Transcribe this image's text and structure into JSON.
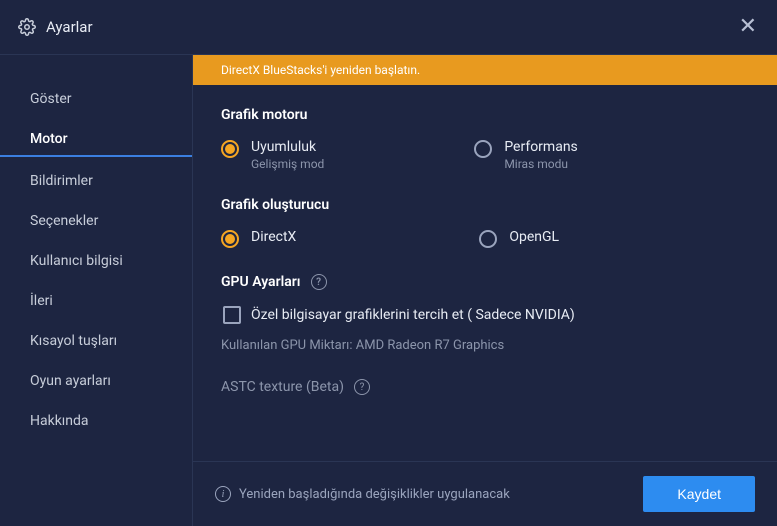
{
  "title": "Ayarlar",
  "alert": "DirectX BlueStacks'i yeniden başlatın.",
  "sidebar": {
    "items": [
      {
        "label": "Göster"
      },
      {
        "label": "Motor"
      },
      {
        "label": "Bildirimler"
      },
      {
        "label": "Seçenekler"
      },
      {
        "label": "Kullanıcı bilgisi"
      },
      {
        "label": "İleri"
      },
      {
        "label": "Kısayol tuşları"
      },
      {
        "label": "Oyun ayarları"
      },
      {
        "label": "Hakkında"
      }
    ],
    "active_index": 1
  },
  "sections": {
    "engine": {
      "title": "Grafik motoru",
      "options": [
        {
          "label": "Uyumluluk",
          "sub": "Gelişmiş mod",
          "selected": true
        },
        {
          "label": "Performans",
          "sub": "Miras modu",
          "selected": false
        }
      ]
    },
    "renderer": {
      "title": "Grafik oluşturucu",
      "options": [
        {
          "label": "DirectX",
          "selected": true
        },
        {
          "label": "OpenGL",
          "selected": false
        }
      ]
    },
    "gpu": {
      "title": "GPU Ayarları",
      "checkbox_label": "Özel bilgisayar grafiklerini tercih et ( Sadece NVIDIA)",
      "checkbox_checked": false,
      "info": "Kullanılan GPU Miktarı: AMD Radeon R7 Graphics"
    },
    "astc": {
      "title": "ASTC texture (Beta)"
    }
  },
  "footer": {
    "note": "Yeniden başladığında değişiklikler uygulanacak",
    "save": "Kaydet"
  }
}
